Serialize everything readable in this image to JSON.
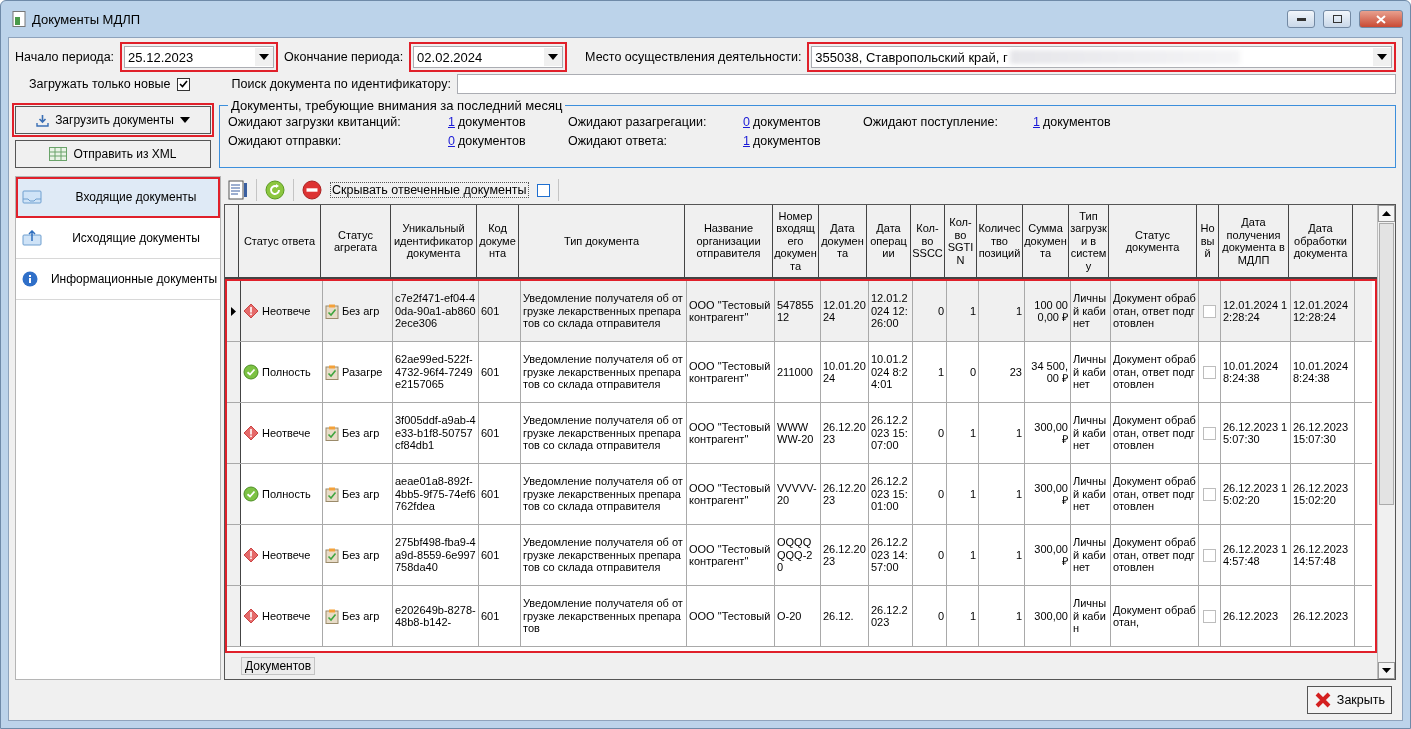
{
  "window": {
    "title": "Документы МДЛП"
  },
  "filters": {
    "start_label": "Начало периода:",
    "start_value": "25.12.2023",
    "end_label": "Окончание периода:",
    "end_value": "02.02.2024",
    "place_label": "Место осуществления деятельности:",
    "place_value": "355038, Ставропольский край, г",
    "only_new_label": "Загружать только новые",
    "only_new_checked": true,
    "search_label": "Поиск документа по идентификатору:"
  },
  "actions": [
    {
      "kind": "download",
      "label": "Загрузить документы"
    },
    {
      "kind": "xml",
      "label": "Отправить из XML"
    }
  ],
  "attention": {
    "title": "Документы, требующие внимания за последний месяц",
    "items": [
      {
        "label": "Ожидают загрузки квитанций:",
        "count": "1",
        "unit": "документов"
      },
      {
        "label": "Ожидают разагрегации:",
        "count": "0",
        "unit": "документов"
      },
      {
        "label": "Ожидают поступление:",
        "count": "1",
        "unit": "документов"
      },
      {
        "label": "Ожидают отправки:",
        "count": "0",
        "unit": "документов"
      },
      {
        "label": "Ожидают ответа:",
        "count": "1",
        "unit": "документов"
      }
    ]
  },
  "sidebar": {
    "items": [
      {
        "kind": "incoming",
        "label": "Входящие документы",
        "selected": true
      },
      {
        "kind": "outgoing",
        "label": "Исходящие документы",
        "selected": false
      },
      {
        "kind": "info",
        "label": "Информационные документы",
        "selected": false
      }
    ]
  },
  "toolbar": {
    "hide_answered_label": "Скрывать отвеченные документы",
    "hide_answered_checked": false
  },
  "table": {
    "columns": [
      "Статус ответа",
      "Статус агрегата",
      "Уникальный идентификатор документа",
      "Код документа",
      "Тип документа",
      "Название организации отправителя",
      "Номер входящего документа",
      "Дата документа",
      "Дата операции",
      "Кол-во SSCC",
      "Кол-во SGTIN",
      "Количество позиций",
      "Сумма документа",
      "Тип загрузки в систему",
      "Статус документа",
      "Новый",
      "Дата получения документа в МДЛП",
      "Дата обработки документа"
    ],
    "rows": [
      {
        "current": true,
        "kind": "warning",
        "new": false,
        "cells": [
          "Неотвече",
          "Без агр",
          "c7e2f471-ef04-40da-90a1-ab8602ece306",
          "601",
          "Уведомление получателя об отгрузке лекарственных препаратов со склада отправителя",
          "ООО \"Тестовый контрагент\"",
          "54785512",
          "12.01.2024",
          "12.01.2024 12:26:00",
          "0",
          "1",
          "1",
          "100 000,00 ₽",
          "Личный кабинет",
          "Документ обработан, ответ подготовлен",
          "",
          "12.01.2024 12:28:24",
          "12.01.2024 12:28:24"
        ]
      },
      {
        "current": false,
        "kind": "ok",
        "new": false,
        "cells": [
          "Полность",
          "Разагре",
          "62ae99ed-522f-4732-96f4-7249e2157065",
          "601",
          "Уведомление получателя об отгрузке лекарственных препаратов со склада отправителя",
          "ООО \"Тестовый контрагент\"",
          "211000",
          "10.01.2024",
          "10.01.2024 8:24:01",
          "1",
          "0",
          "23",
          "34 500,00 ₽",
          "Личный кабинет",
          "Документ обработан, ответ подготовлен",
          "",
          "10.01.2024 8:24:38",
          "10.01.2024 8:24:38"
        ]
      },
      {
        "current": false,
        "kind": "warning",
        "new": false,
        "cells": [
          "Неотвече",
          "Без агр",
          "3f005ddf-a9ab-4e33-b1f8-50757cf84db1",
          "601",
          "Уведомление получателя об отгрузке лекарственных препаратов со склада отправителя",
          "ООО \"Тестовый контрагент\"",
          "WWWWW-20",
          "26.12.2023",
          "26.12.2023 15:07:00",
          "0",
          "1",
          "1",
          "300,00 ₽",
          "Личный кабинет",
          "Документ обработан, ответ подготовлен",
          "",
          "26.12.2023 15:07:30",
          "26.12.2023 15:07:30"
        ]
      },
      {
        "current": false,
        "kind": "ok",
        "new": false,
        "cells": [
          "Полность",
          "Без агр",
          "aeae01a8-892f-4bb5-9f75-74ef6762fdea",
          "601",
          "Уведомление получателя об отгрузке лекарственных препаратов со склада отправителя",
          "ООО \"Тестовый контрагент\"",
          "VVVVV-20",
          "26.12.2023",
          "26.12.2023 15:01:00",
          "0",
          "1",
          "1",
          "300,00 ₽",
          "Личный кабинет",
          "Документ обработан, ответ подготовлен",
          "",
          "26.12.2023 15:02:20",
          "26.12.2023 15:02:20"
        ]
      },
      {
        "current": false,
        "kind": "warning",
        "new": false,
        "cells": [
          "Неотвече",
          "Без агр",
          "275bf498-fba9-4a9d-8559-6e997758da40",
          "601",
          "Уведомление получателя об отгрузке лекарственных препаратов со склада отправителя",
          "ООО \"Тестовый контрагент\"",
          "OQQQQQQ-20",
          "26.12.2023",
          "26.12.2023 14:57:00",
          "0",
          "1",
          "1",
          "300,00 ₽",
          "Личный кабинет",
          "Документ обработан, ответ подготовлен",
          "",
          "26.12.2023 14:57:48",
          "26.12.2023 14:57:48"
        ]
      },
      {
        "current": false,
        "kind": "warning",
        "new": false,
        "cells": [
          "Неотвече",
          "Без агр",
          "e202649b-8278-48b8-b142-",
          "601",
          "Уведомление получателя об отгрузке лекарственных препаратов",
          "ООО \"Тестовый",
          "O-20",
          "26.12.",
          "26.12.2023",
          "0",
          "1",
          "1",
          "300,00",
          "Личный кабин",
          "Документ обработан,",
          "",
          "26.12.2023",
          "26.12.2023"
        ]
      }
    ]
  },
  "footer_tab": "Документов",
  "close_button": "Закрыть"
}
